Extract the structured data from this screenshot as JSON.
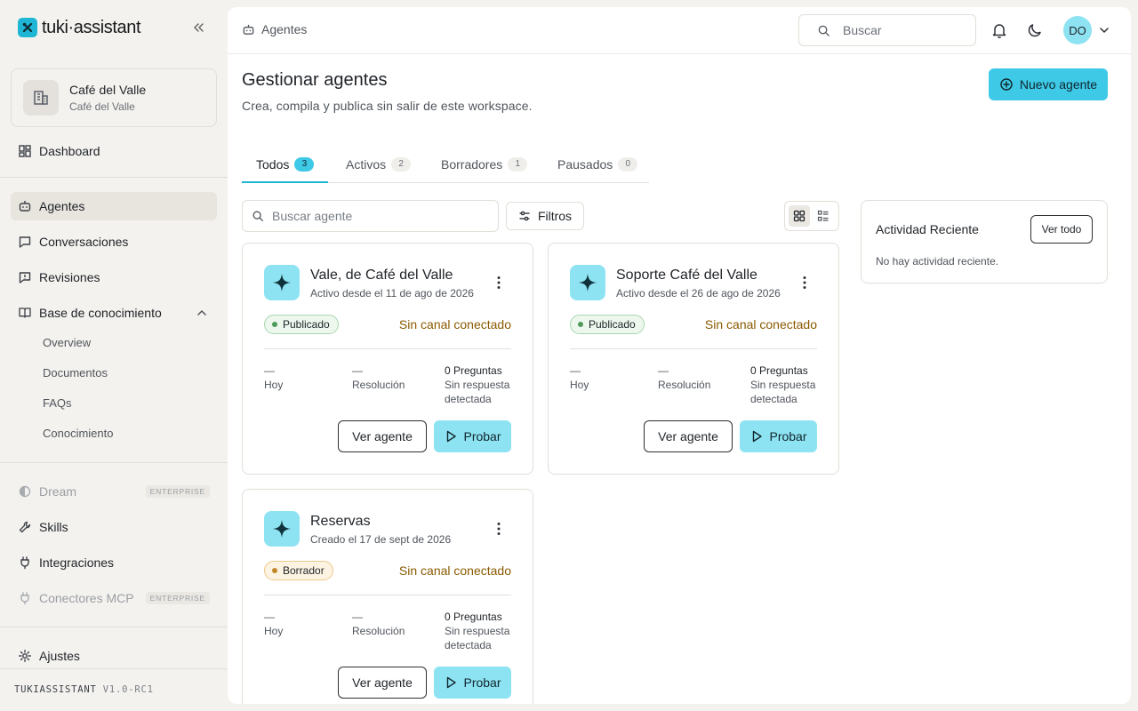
{
  "app": {
    "brand": "tuki·assistant",
    "version_name": "TUKIASSISTANT",
    "version_num": "V1.0-RC1"
  },
  "workspace": {
    "name": "Café del Valle",
    "sub": "Café del Valle"
  },
  "sidebar": {
    "dashboard": "Dashboard",
    "agentes": "Agentes",
    "conversaciones": "Conversaciones",
    "revisiones": "Revisiones",
    "base": "Base de conocimiento",
    "sub_items": [
      "Overview",
      "Documentos",
      "FAQs",
      "Conocimiento"
    ],
    "dream": "Dream",
    "skills": "Skills",
    "integraciones": "Integraciones",
    "conectores": "Conectores MCP",
    "enterprise": "ENTERPRISE",
    "ajustes": "Ajustes"
  },
  "topbar": {
    "breadcrumb": "Agentes",
    "search_placeholder": "Buscar",
    "avatar": "DO"
  },
  "page": {
    "title": "Gestionar agentes",
    "subtitle": "Crea, compila y publica sin salir de este workspace.",
    "new_button": "Nuevo agente"
  },
  "tabs": [
    {
      "label": "Todos",
      "count": "3"
    },
    {
      "label": "Activos",
      "count": "2"
    },
    {
      "label": "Borradores",
      "count": "1"
    },
    {
      "label": "Pausados",
      "count": "0"
    }
  ],
  "toolbar": {
    "search_placeholder": "Buscar agente",
    "filters": "Filtros"
  },
  "cards": [
    {
      "title": "Vale, de Café del Valle",
      "date": "Activo desde el 11 de ago de 2026",
      "status": "Publicado",
      "channel": "Sin canal conectado",
      "m1_value": "—",
      "m1_label": "Hoy",
      "m2_value": "—",
      "m2_label": "Resolución",
      "m3_value": "0 Preguntas",
      "m3_l1": "Sin respuesta",
      "m3_l2": "detectada",
      "view": "Ver agente",
      "try": "Probar"
    },
    {
      "title": "Soporte Café del Valle",
      "date": "Activo desde el 26 de ago de 2026",
      "status": "Publicado",
      "channel": "Sin canal conectado",
      "m1_value": "—",
      "m1_label": "Hoy",
      "m2_value": "—",
      "m2_label": "Resolución",
      "m3_value": "0 Preguntas",
      "m3_l1": "Sin respuesta",
      "m3_l2": "detectada",
      "view": "Ver agente",
      "try": "Probar"
    },
    {
      "title": "Reservas",
      "date": "Creado el 17 de sept de 2026",
      "status": "Borrador",
      "channel": "Sin canal conectado",
      "m1_value": "—",
      "m1_label": "Hoy",
      "m2_value": "—",
      "m2_label": "Resolución",
      "m3_value": "0 Preguntas",
      "m3_l1": "Sin respuesta",
      "m3_l2": "detectada",
      "view": "Ver agente",
      "try": "Probar"
    }
  ],
  "activity": {
    "title": "Actividad Reciente",
    "button": "Ver todo",
    "empty": "No hay actividad reciente."
  },
  "colors": {
    "accent": "#3ec9e7",
    "accent_soft": "#8ee3f3",
    "warning_text": "#8a5a00"
  }
}
